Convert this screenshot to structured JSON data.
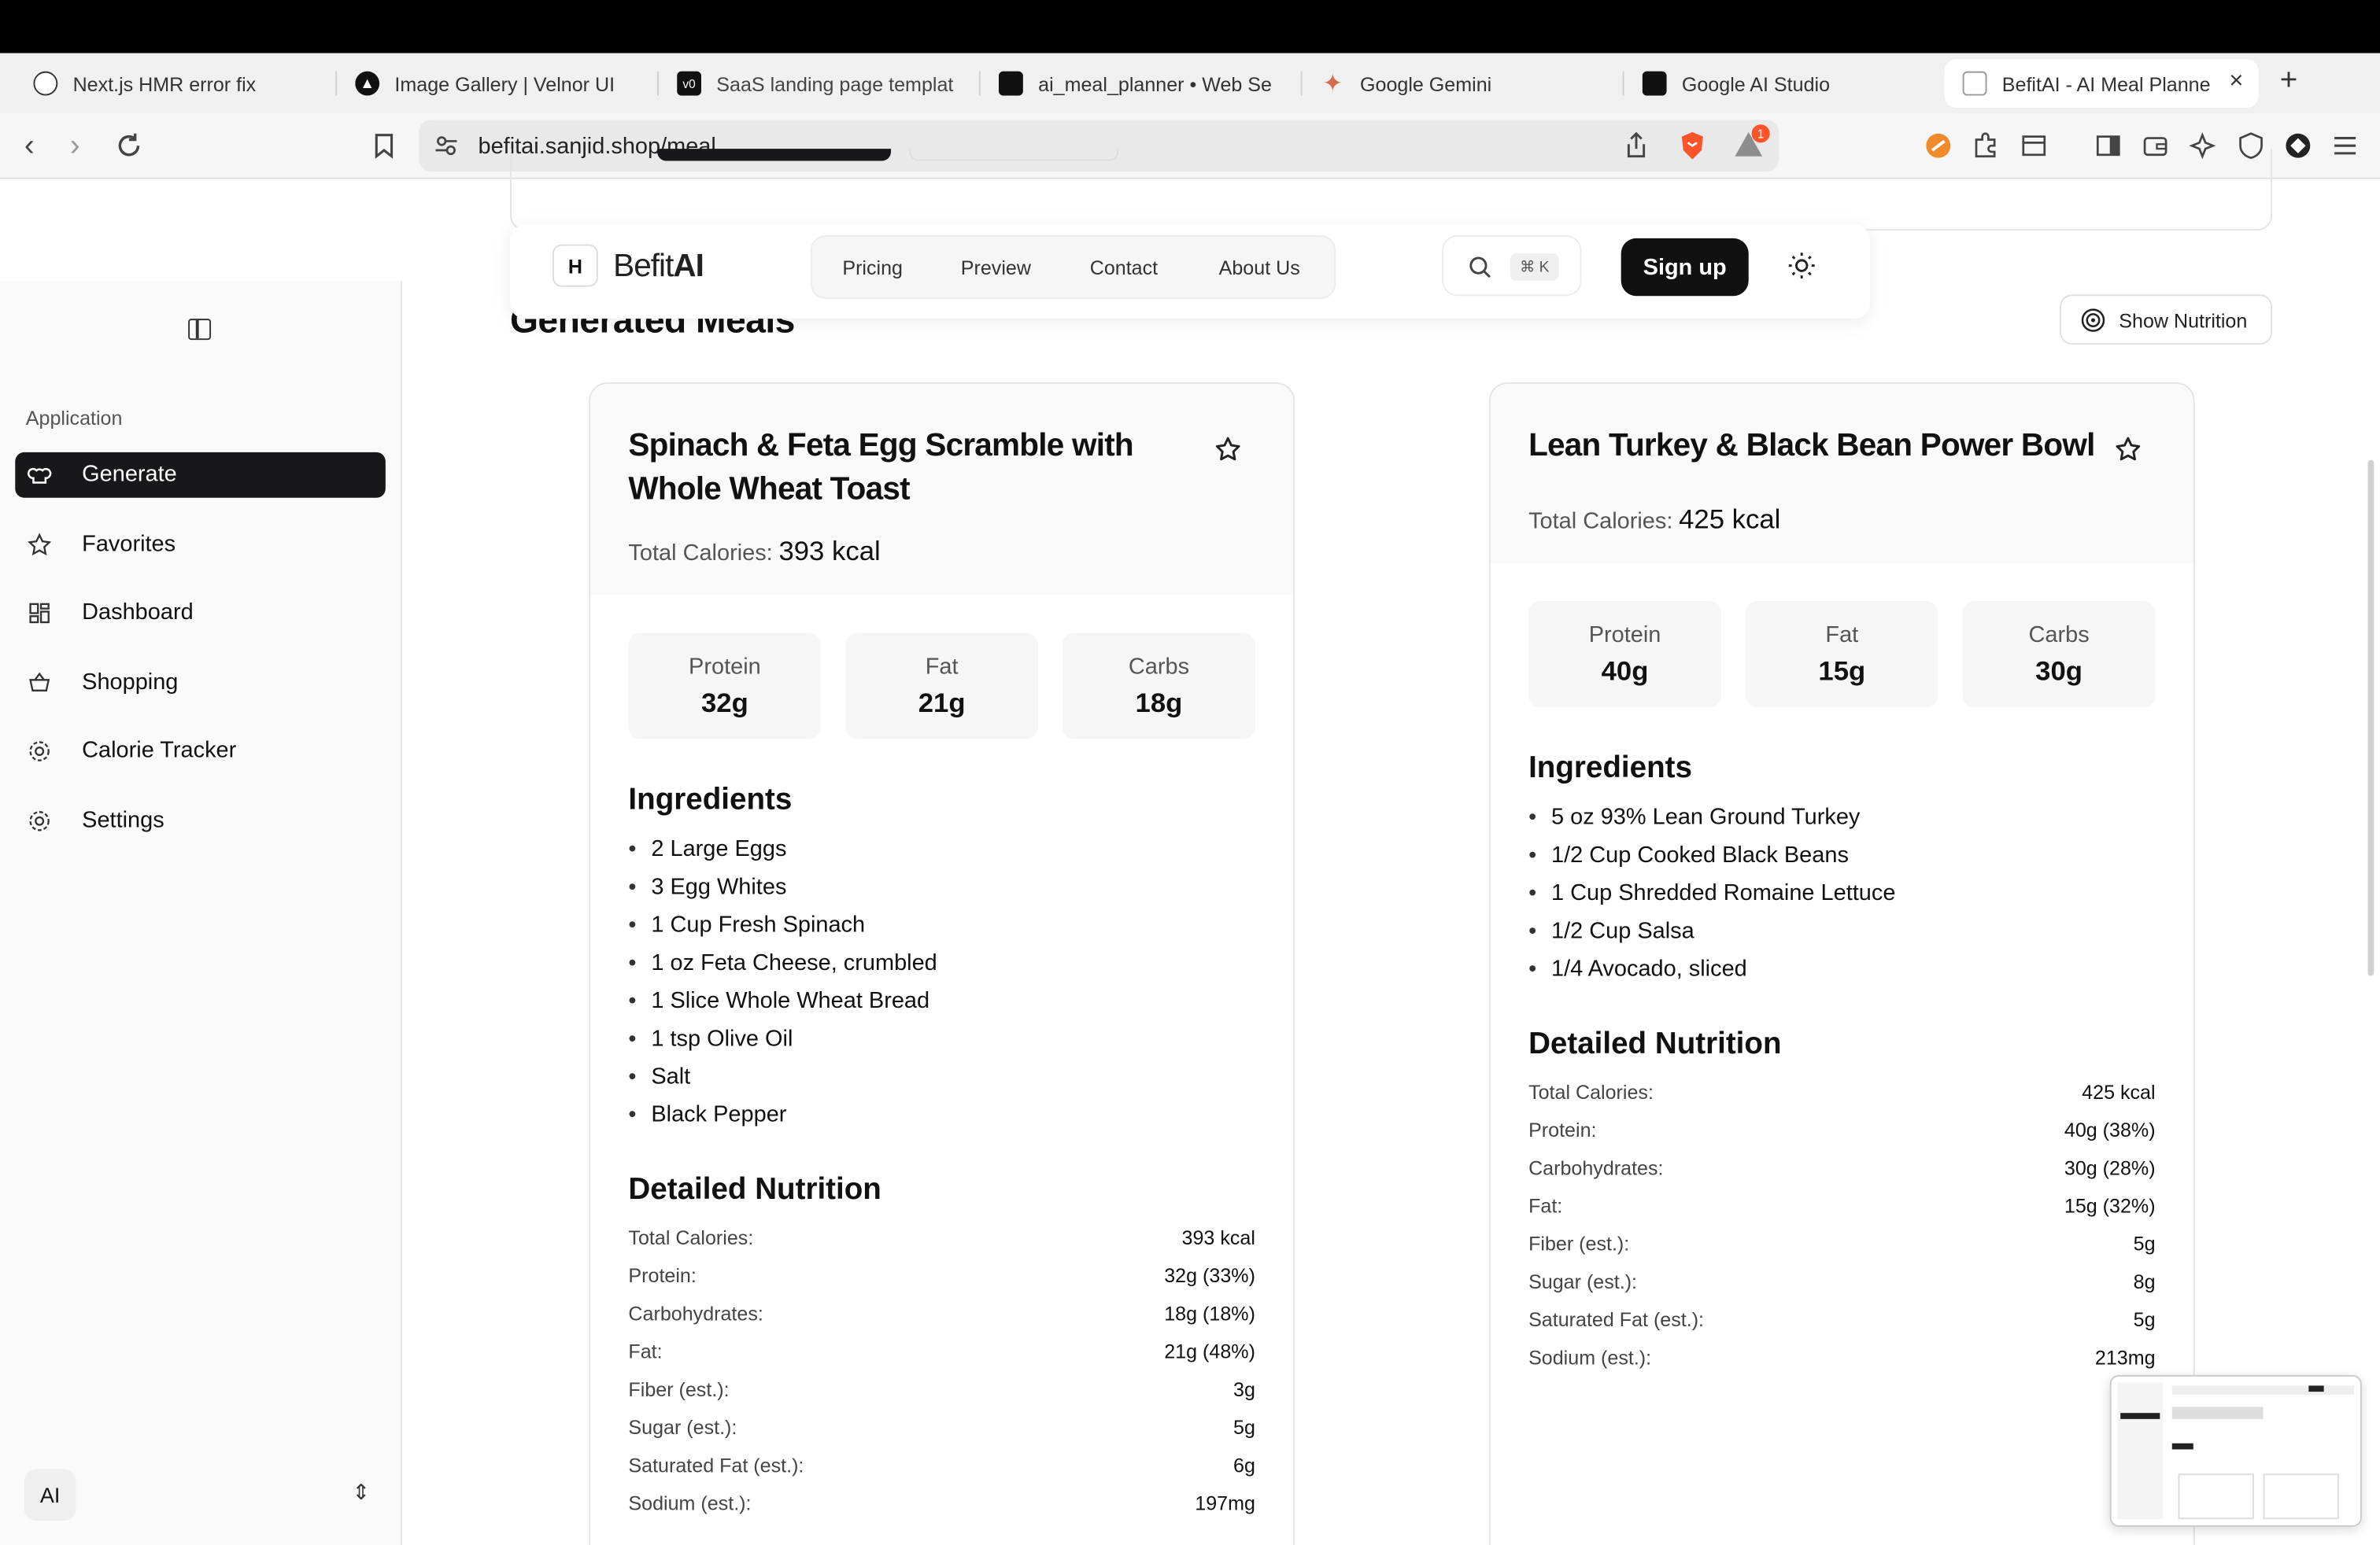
{
  "browser": {
    "tabs": [
      {
        "label": "Next.js HMR error fix",
        "icon": "openai-icon"
      },
      {
        "label": "Image Gallery | Velnor UI",
        "icon": "velnor-icon"
      },
      {
        "label": "SaaS landing page templat",
        "icon": "v0-icon"
      },
      {
        "label": "ai_meal_planner  •  Web Se",
        "icon": "render-icon"
      },
      {
        "label": "Google Gemini",
        "icon": "gemini-icon"
      },
      {
        "label": "Google AI Studio",
        "icon": "ai-studio-icon"
      },
      {
        "label": "BefitAI - AI Meal Planne",
        "icon": "befitai-icon"
      }
    ],
    "url": "befitai.sanjid.shop/meal",
    "notification_count": "1"
  },
  "sidebar": {
    "group_label": "Application",
    "items": [
      {
        "label": "Generate",
        "icon": "chef-hat-icon"
      },
      {
        "label": "Favorites",
        "icon": "star-icon"
      },
      {
        "label": "Dashboard",
        "icon": "dashboard-icon"
      },
      {
        "label": "Shopping",
        "icon": "basket-icon"
      },
      {
        "label": "Calorie Tracker",
        "icon": "gear-icon"
      },
      {
        "label": "Settings",
        "icon": "settings-icon"
      }
    ],
    "footer_avatar": "AI"
  },
  "navbar": {
    "logo_prefix": "Befit",
    "logo_suffix": "AI",
    "links": [
      "Pricing",
      "Preview",
      "Contact",
      "About Us"
    ],
    "search_shortcut": "⌘ K",
    "signup_label": "Sign up"
  },
  "main": {
    "title": "Generated Meals",
    "show_nutrition_label": "Show Nutrition"
  },
  "meals": [
    {
      "title": "Spinach & Feta Egg Scramble with Whole Wheat Toast",
      "total_calories_label": "Total Calories:",
      "total_calories": "393 kcal",
      "macros": [
        {
          "label": "Protein",
          "value": "32g"
        },
        {
          "label": "Fat",
          "value": "21g"
        },
        {
          "label": "Carbs",
          "value": "18g"
        }
      ],
      "ingredients_heading": "Ingredients",
      "ingredients": [
        "2 Large Eggs",
        "3 Egg Whites",
        "1 Cup Fresh Spinach",
        "1 oz Feta Cheese, crumbled",
        "1 Slice Whole Wheat Bread",
        "1 tsp Olive Oil",
        "Salt",
        "Black Pepper"
      ],
      "nutrition_heading": "Detailed Nutrition",
      "nutrition": [
        {
          "label": "Total Calories:",
          "value": "393 kcal"
        },
        {
          "label": "Protein:",
          "value": "32g (33%)"
        },
        {
          "label": "Carbohydrates:",
          "value": "18g (18%)"
        },
        {
          "label": "Fat:",
          "value": "21g (48%)"
        },
        {
          "label": "Fiber (est.):",
          "value": "3g"
        },
        {
          "label": "Sugar (est.):",
          "value": "5g"
        },
        {
          "label": "Saturated Fat (est.):",
          "value": "6g"
        },
        {
          "label": "Sodium (est.):",
          "value": "197mg"
        }
      ]
    },
    {
      "title": "Lean Turkey & Black Bean Power Bowl",
      "total_calories_label": "Total Calories:",
      "total_calories": "425 kcal",
      "macros": [
        {
          "label": "Protein",
          "value": "40g"
        },
        {
          "label": "Fat",
          "value": "15g"
        },
        {
          "label": "Carbs",
          "value": "30g"
        }
      ],
      "ingredients_heading": "Ingredients",
      "ingredients": [
        "5 oz 93% Lean Ground Turkey",
        "1/2 Cup Cooked Black Beans",
        "1 Cup Shredded Romaine Lettuce",
        "1/2 Cup Salsa",
        "1/4 Avocado, sliced"
      ],
      "nutrition_heading": "Detailed Nutrition",
      "nutrition": [
        {
          "label": "Total Calories:",
          "value": "425 kcal"
        },
        {
          "label": "Protein:",
          "value": "40g (38%)"
        },
        {
          "label": "Carbohydrates:",
          "value": "30g (28%)"
        },
        {
          "label": "Fat:",
          "value": "15g (32%)"
        },
        {
          "label": "Fiber (est.):",
          "value": "5g"
        },
        {
          "label": "Sugar (est.):",
          "value": "8g"
        },
        {
          "label": "Saturated Fat (est.):",
          "value": "5g"
        },
        {
          "label": "Sodium (est.):",
          "value": "213mg"
        }
      ]
    }
  ],
  "colors": {
    "accent_dark": "#18181b",
    "brave_orange": "#fb542b"
  }
}
